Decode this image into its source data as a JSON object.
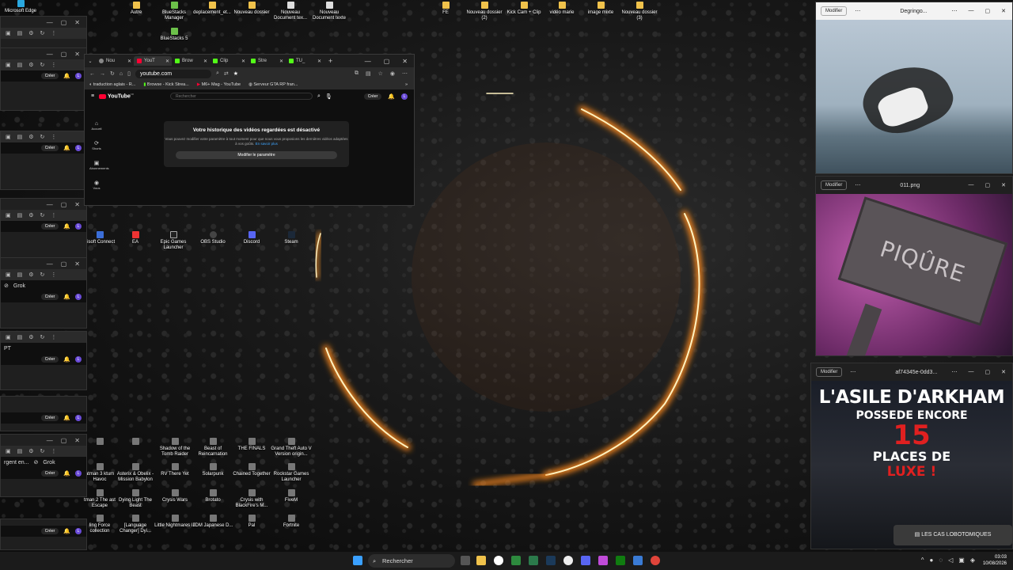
{
  "desktop_top_icons": [
    "Microsoft Edge",
    "Autre",
    "BlueStacks Manager",
    "deplacement_et...",
    "Nouveau dossier",
    "Nouveau Document tex...",
    "Nouveau Document texte",
    "FE",
    "Nouveau dossier (2)",
    "Kick Cam + Clip",
    "vidéo marie",
    "image mixte",
    "Nouveau dossier (3)"
  ],
  "bluestacks_icon": "BlueStacks 5",
  "desktop_mid_icons": [
    "bisoft Connect",
    "EA",
    "Epic Games Launcher",
    "OBS Studio",
    "Discord",
    "Steam"
  ],
  "desktop_games": [
    [
      "",
      "",
      "Shadow of the Tomb Raider",
      "Beast of Reincarnation",
      "THE FINALS",
      "Grand Theft Auto V Version origin..."
    ],
    [
      "atman 3 ktum Havoc",
      "Asterix & Obelix - Mission Babylon",
      "RV There Yet",
      "Solarpunk",
      "Chained Together",
      "Rockstar Games Launcher"
    ],
    [
      "tman 2 The ast Escape",
      "Dying Light The Beast",
      "Crysis Wars",
      "Brotato",
      "Crysis with BlackFire's M...",
      "FiveM"
    ],
    [
      "ling Force collection",
      "[Language Changer] Dyi...",
      "Little Nightmares III",
      "JDM Japanese D...",
      "Pal",
      "Fortnite"
    ]
  ],
  "left_windows": {
    "creer": "Créer",
    "avatar": "L",
    "grok": "Grok",
    "argent": "rgent en...",
    "pt": "PT"
  },
  "browser": {
    "tabs": [
      "Nou",
      "YouT",
      "Brow",
      "Clip",
      "Stre",
      "TU_"
    ],
    "url": "youtube.com",
    "bookmarks": [
      "traduction aglais - R...",
      "Browse - Kick Strea...",
      "M6+ Mag - YouTube",
      "Serveur GTA RP fran..."
    ],
    "yt_logo": "YouTube",
    "yt_country": "FR",
    "search_placeholder": "Rechercher",
    "creer": "Créer",
    "avatar": "L",
    "side": [
      "Accueil",
      "Shorts",
      "Abonnements",
      "Vous"
    ],
    "card_title": "Votre historique des vidéos regardées est désactivé",
    "card_text": "Vous pouvez modifier votre paramètre à tout moment pour que nous vous proposions les dernières vidéos adaptées à vos goûts.",
    "card_link": "En savoir plus",
    "card_button": "Modifier le paramètre"
  },
  "right_windows": [
    {
      "modify": "Modifier",
      "title": "Degringo..."
    },
    {
      "modify": "Modifier",
      "title": "011.png",
      "sign": "PIQÛRE"
    },
    {
      "modify": "Modifier",
      "title": "af74345e-0dd3...",
      "line1": "L'ASILE D'ARKHAM",
      "line2": "POSSEDE ENCORE",
      "line3": "15",
      "line4": "PLACES DE",
      "line5": "LUXE !",
      "caption": "LES CAS LOBOTOMIQUES"
    }
  ],
  "taskbar": {
    "search": "Rechercher",
    "time": "03:03",
    "date": "10/08/2026"
  },
  "colors": {
    "ring": "#ff9a2a",
    "ring_core": "#fff2c0",
    "yt_red": "#ff0033",
    "accent": "#3ea6ff"
  }
}
